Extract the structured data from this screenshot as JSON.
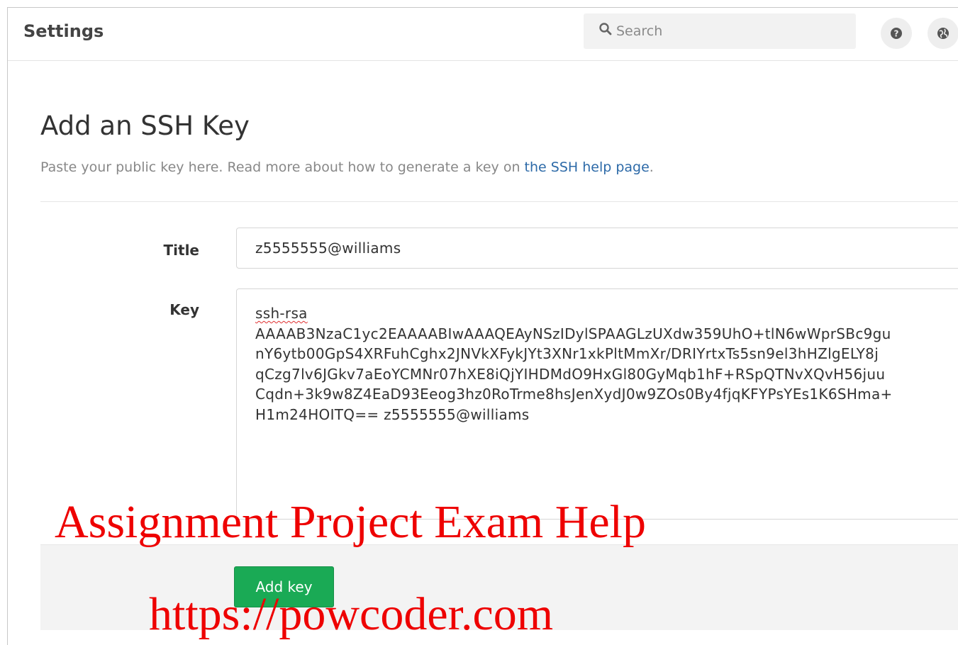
{
  "header": {
    "title": "Settings",
    "search_placeholder": "Search",
    "icons": [
      "help-icon",
      "globe-icon"
    ]
  },
  "page": {
    "heading": "Add an SSH Key",
    "subtitle_prefix": "Paste your public key here. Read more about how to generate a key on ",
    "subtitle_link": "the SSH help page",
    "subtitle_suffix": "."
  },
  "form": {
    "title_label": "Title",
    "title_value": "z5555555@williams",
    "key_label": "Key",
    "key_lines": [
      "ssh-rsa",
      "AAAAB3NzaC1yc2EAAAABIwAAAQEAyNSzIDylSPAAGLzUXdw359UhO+tlN6wWprSBc9gu",
      "nY6ytb00GpS4XRFuhCghx2JNVkXFykJYt3XNr1xkPltMmXr/DRIYrtxTs5sn9el3hHZlgELY8j",
      "qCzg7lv6JGkv7aEoYCMNr07hXE8iQjYIHDMdO9HxGl80GyMqb1hF+RSpQTNvXQvH56juu",
      "Cqdn+3k9w8Z4EaD93Eeog3hz0RoTrme8hsJenXydJ0w9ZOs0By4fjqKFYPsYEs1K6SHma+",
      "H1m24HOITQ== z5555555@williams"
    ],
    "submit_label": "Add key"
  },
  "watermark": {
    "line1": "Assignment Project Exam Help",
    "line2": "https://powcoder.com"
  },
  "colors": {
    "accent_green": "#1aaa55",
    "link_blue": "#2d6aa8",
    "watermark_red": "#ee0000"
  }
}
